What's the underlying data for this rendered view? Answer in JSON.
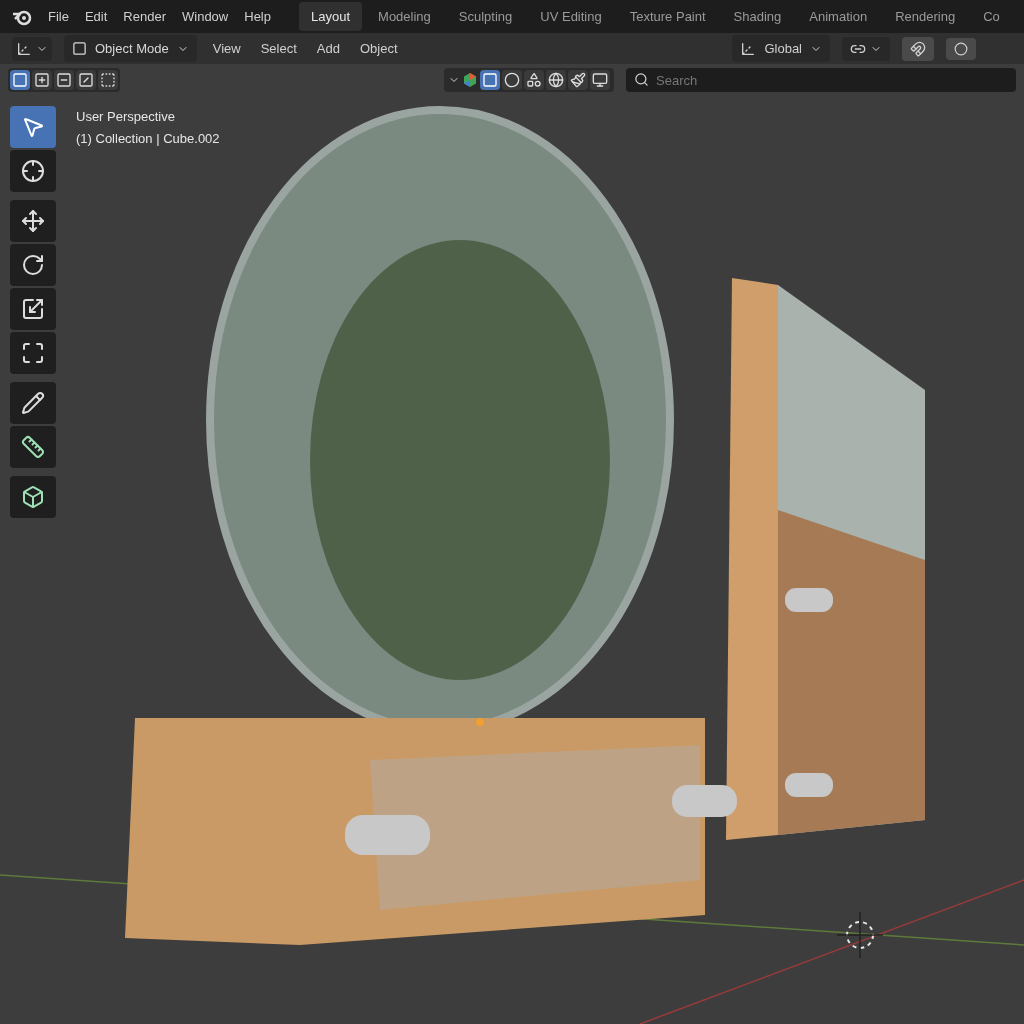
{
  "menu": [
    "File",
    "Edit",
    "Render",
    "Window",
    "Help"
  ],
  "workspaces": [
    {
      "label": "Layout",
      "selected": true
    },
    {
      "label": "Modeling",
      "selected": false
    },
    {
      "label": "Sculpting",
      "selected": false
    },
    {
      "label": "UV Editing",
      "selected": false
    },
    {
      "label": "Texture Paint",
      "selected": false
    },
    {
      "label": "Shading",
      "selected": false
    },
    {
      "label": "Animation",
      "selected": false
    },
    {
      "label": "Rendering",
      "selected": false
    },
    {
      "label": "Co",
      "selected": false
    }
  ],
  "header": {
    "mode": "Object Mode",
    "menus": [
      "View",
      "Select",
      "Add",
      "Object"
    ],
    "orientation": "Global"
  },
  "select_modes": [
    {
      "kind": "set",
      "selected": true
    },
    {
      "kind": "extend",
      "selected": false
    },
    {
      "kind": "subtract",
      "selected": false
    },
    {
      "kind": "invert",
      "selected": false
    },
    {
      "kind": "intersect",
      "selected": false
    }
  ],
  "shading_buttons": [
    {
      "kind": "solid",
      "selected": true
    },
    {
      "kind": "material",
      "selected": false
    },
    {
      "kind": "objects",
      "selected": false
    },
    {
      "kind": "world",
      "selected": false
    },
    {
      "kind": "paint",
      "selected": false
    },
    {
      "kind": "display",
      "selected": false
    }
  ],
  "search": {
    "placeholder": "Search"
  },
  "viewport": {
    "title": "User Perspective",
    "subtitle": "(1) Collection | Cube.002"
  },
  "tools": [
    {
      "kind": "select",
      "selected": true
    },
    {
      "kind": "cursor",
      "selected": false
    },
    {
      "kind": "move",
      "selected": false
    },
    {
      "kind": "rotate",
      "selected": false
    },
    {
      "kind": "scale",
      "selected": false
    },
    {
      "kind": "transform",
      "selected": false
    },
    {
      "kind": "annotate",
      "selected": false
    },
    {
      "kind": "measure",
      "selected": false
    },
    {
      "kind": "add",
      "selected": false
    }
  ]
}
